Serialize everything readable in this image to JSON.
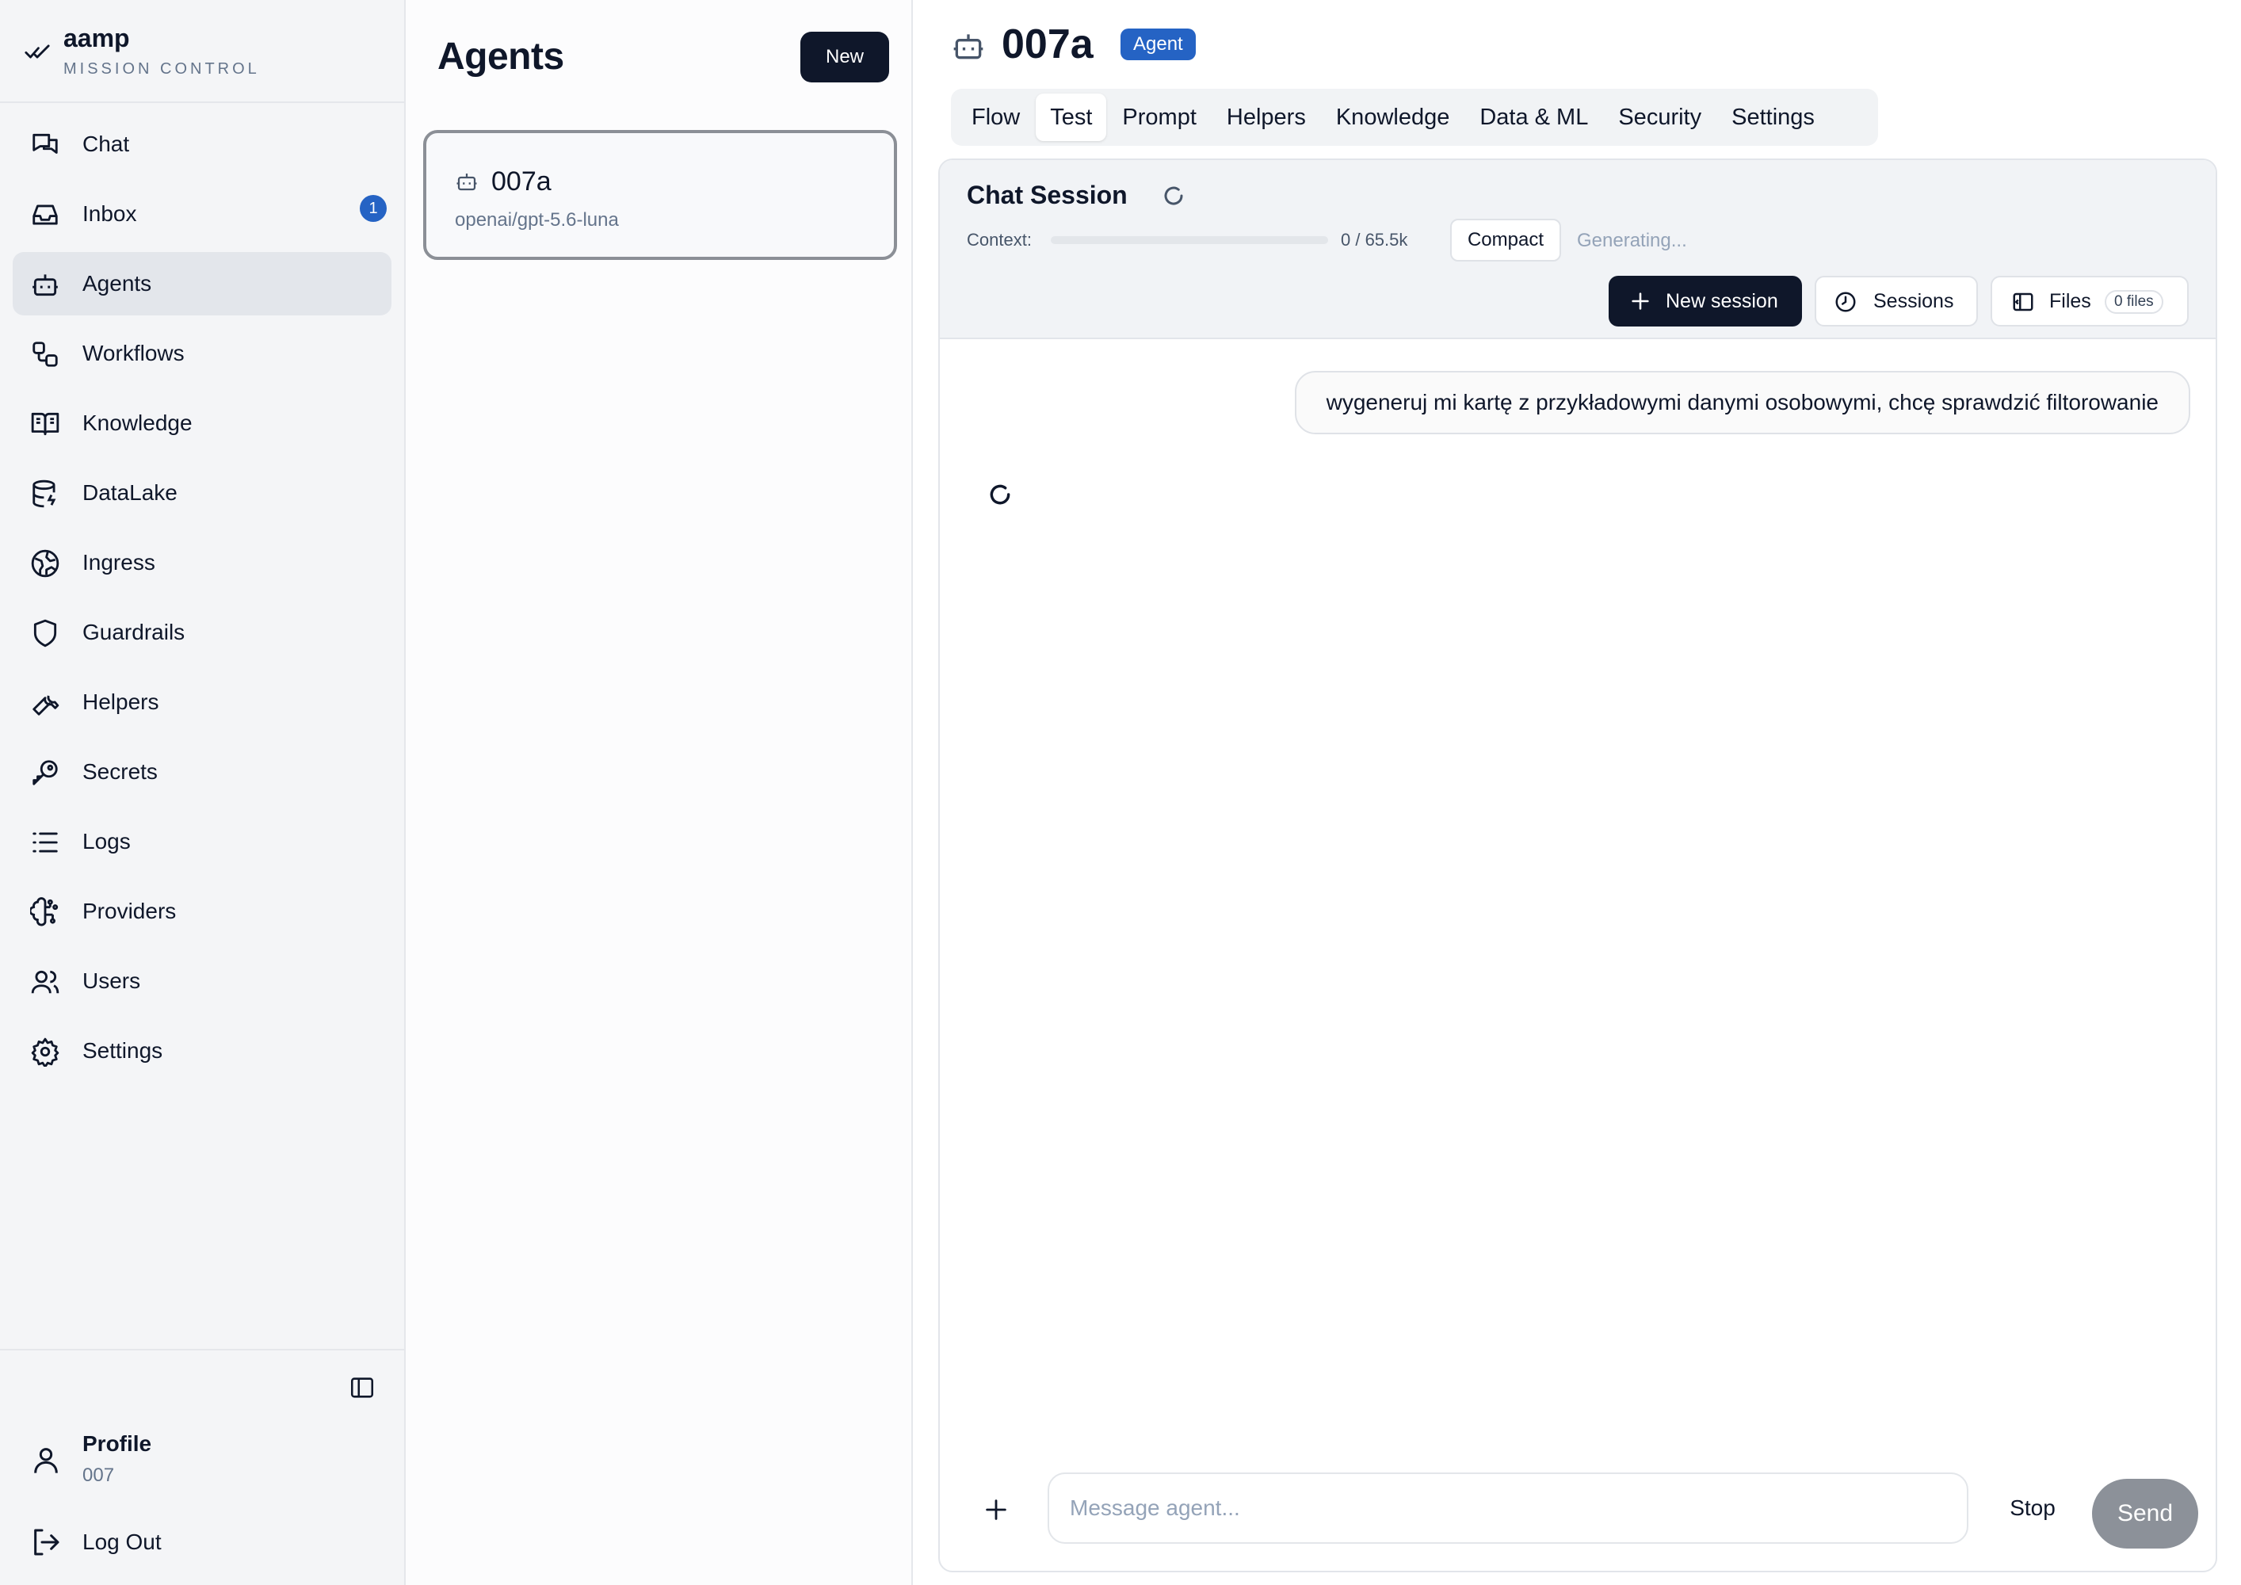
{
  "brand": {
    "name": "aamp",
    "subtitle": "MISSION CONTROL"
  },
  "sidebar": {
    "items": [
      {
        "label": "Chat",
        "icon": "chat-icon"
      },
      {
        "label": "Inbox",
        "icon": "inbox-icon",
        "badge": "1"
      },
      {
        "label": "Agents",
        "icon": "bot-icon",
        "active": true
      },
      {
        "label": "Workflows",
        "icon": "workflow-icon"
      },
      {
        "label": "Knowledge",
        "icon": "book-icon"
      },
      {
        "label": "DataLake",
        "icon": "database-icon"
      },
      {
        "label": "Ingress",
        "icon": "globe-icon"
      },
      {
        "label": "Guardrails",
        "icon": "shield-icon"
      },
      {
        "label": "Helpers",
        "icon": "wrench-icon"
      },
      {
        "label": "Secrets",
        "icon": "key-icon"
      },
      {
        "label": "Logs",
        "icon": "list-icon"
      },
      {
        "label": "Providers",
        "icon": "brain-icon"
      },
      {
        "label": "Users",
        "icon": "users-icon"
      },
      {
        "label": "Settings",
        "icon": "gear-icon"
      }
    ],
    "profile": {
      "label": "Profile",
      "sub": "007"
    },
    "logout": "Log Out"
  },
  "agents": {
    "title": "Agents",
    "new_label": "New",
    "list": [
      {
        "name": "007a",
        "model": "openai/gpt-5.6-luna"
      }
    ]
  },
  "main": {
    "title": "007a",
    "badge": "Agent",
    "tabs": [
      "Flow",
      "Test",
      "Prompt",
      "Helpers",
      "Knowledge",
      "Data & ML",
      "Security",
      "Settings"
    ],
    "active_tab": "Test",
    "session": {
      "title": "Chat Session",
      "context_label": "Context:",
      "context_value": "0 / 65.5k",
      "context_fraction": 0,
      "compact_label": "Compact",
      "status": "Generating...",
      "new_session_label": "New session",
      "sessions_label": "Sessions",
      "files_label": "Files",
      "files_count": "0 files"
    },
    "messages": [
      {
        "role": "user",
        "text": "wygeneruj mi kartę z przykładowymi danymi osobowymi, chcę sprawdzić filtorowanie"
      }
    ],
    "composer": {
      "placeholder": "Message agent...",
      "stop_label": "Stop",
      "send_label": "Send"
    }
  },
  "colors": {
    "accent": "#2563c4",
    "dark": "#0f172a",
    "muted": "#64748b"
  }
}
